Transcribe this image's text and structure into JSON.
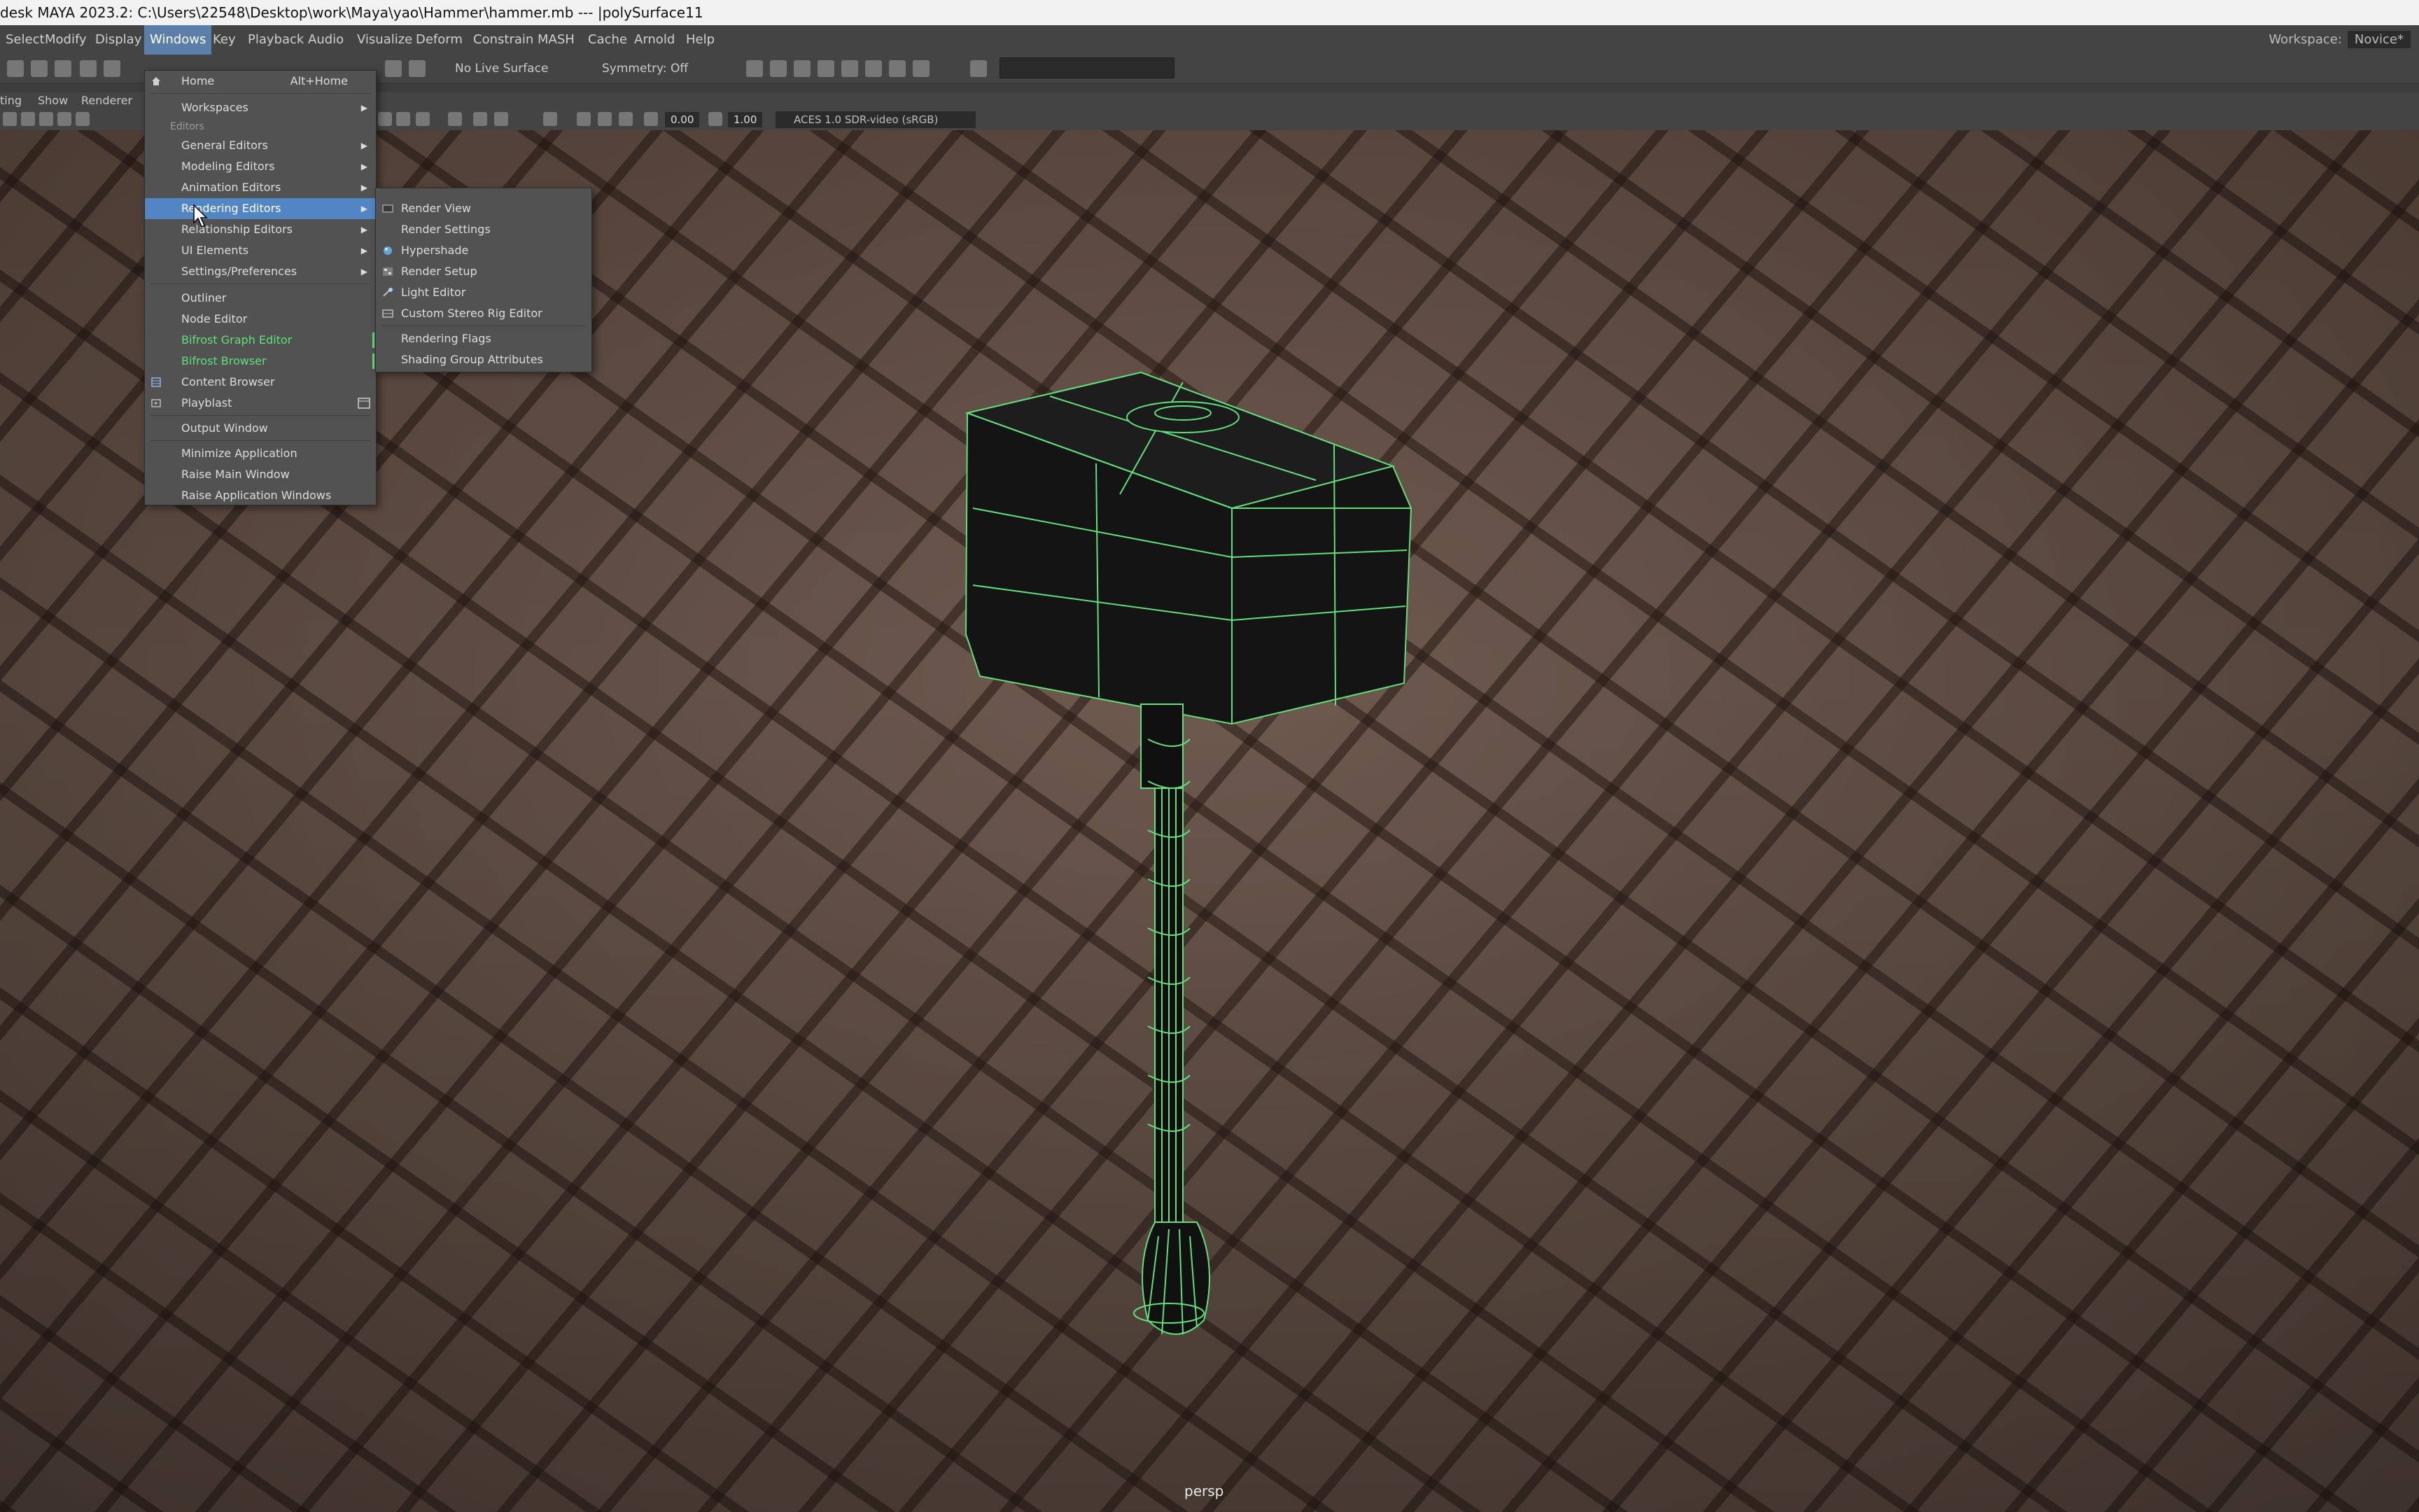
{
  "titlebar": {
    "text": "desk MAYA 2023.2: C:\\Users\\22548\\Desktop\\work\\Maya\\yao\\Hammer\\hammer.mb   ---   |polySurface11"
  },
  "menubar": {
    "items": [
      "Select",
      "Modify",
      "Display",
      "Windows",
      "Key",
      "Playback",
      "Audio",
      "Visualize",
      "Deform",
      "Constrain",
      "MASH",
      "Cache",
      "Arnold",
      "Help"
    ],
    "active": "Windows"
  },
  "workspace": {
    "label": "Workspace:",
    "value": "Novice*"
  },
  "toolbar": {
    "live_surface": "No Live Surface",
    "symmetry": "Symmetry: Off"
  },
  "panel_menu": {
    "items": [
      "ting",
      "Show",
      "Renderer"
    ]
  },
  "panel_tools": {
    "exposure": "0.00",
    "gamma": "1.00",
    "color_space": "ACES 1.0 SDR-video (sRGB)"
  },
  "viewport": {
    "camera": "persp",
    "selection_color": "#5fe07a"
  },
  "windows_menu": {
    "home": "Home",
    "home_shortcut": "Alt+Home",
    "workspaces": "Workspaces",
    "section_editors": "Editors",
    "general_editors": "General Editors",
    "modeling_editors": "Modeling Editors",
    "animation_editors": "Animation Editors",
    "rendering_editors": "Rendering Editors",
    "relationship_editors": "Relationship Editors",
    "ui_elements": "UI Elements",
    "settings_preferences": "Settings/Preferences",
    "outliner": "Outliner",
    "node_editor": "Node Editor",
    "bifrost_graph_editor": "Bifrost Graph Editor",
    "bifrost_browser": "Bifrost Browser",
    "content_browser": "Content Browser",
    "playblast": "Playblast",
    "output_window": "Output Window",
    "minimize_application": "Minimize Application",
    "raise_main_window": "Raise Main Window",
    "raise_application_windows": "Raise Application Windows"
  },
  "rendering_submenu": {
    "render_view": "Render View",
    "render_settings": "Render Settings",
    "hypershade": "Hypershade",
    "render_setup": "Render Setup",
    "light_editor": "Light Editor",
    "custom_stereo_rig_editor": "Custom Stereo Rig Editor",
    "rendering_flags": "Rendering Flags",
    "shading_group_attributes": "Shading Group Attributes"
  }
}
